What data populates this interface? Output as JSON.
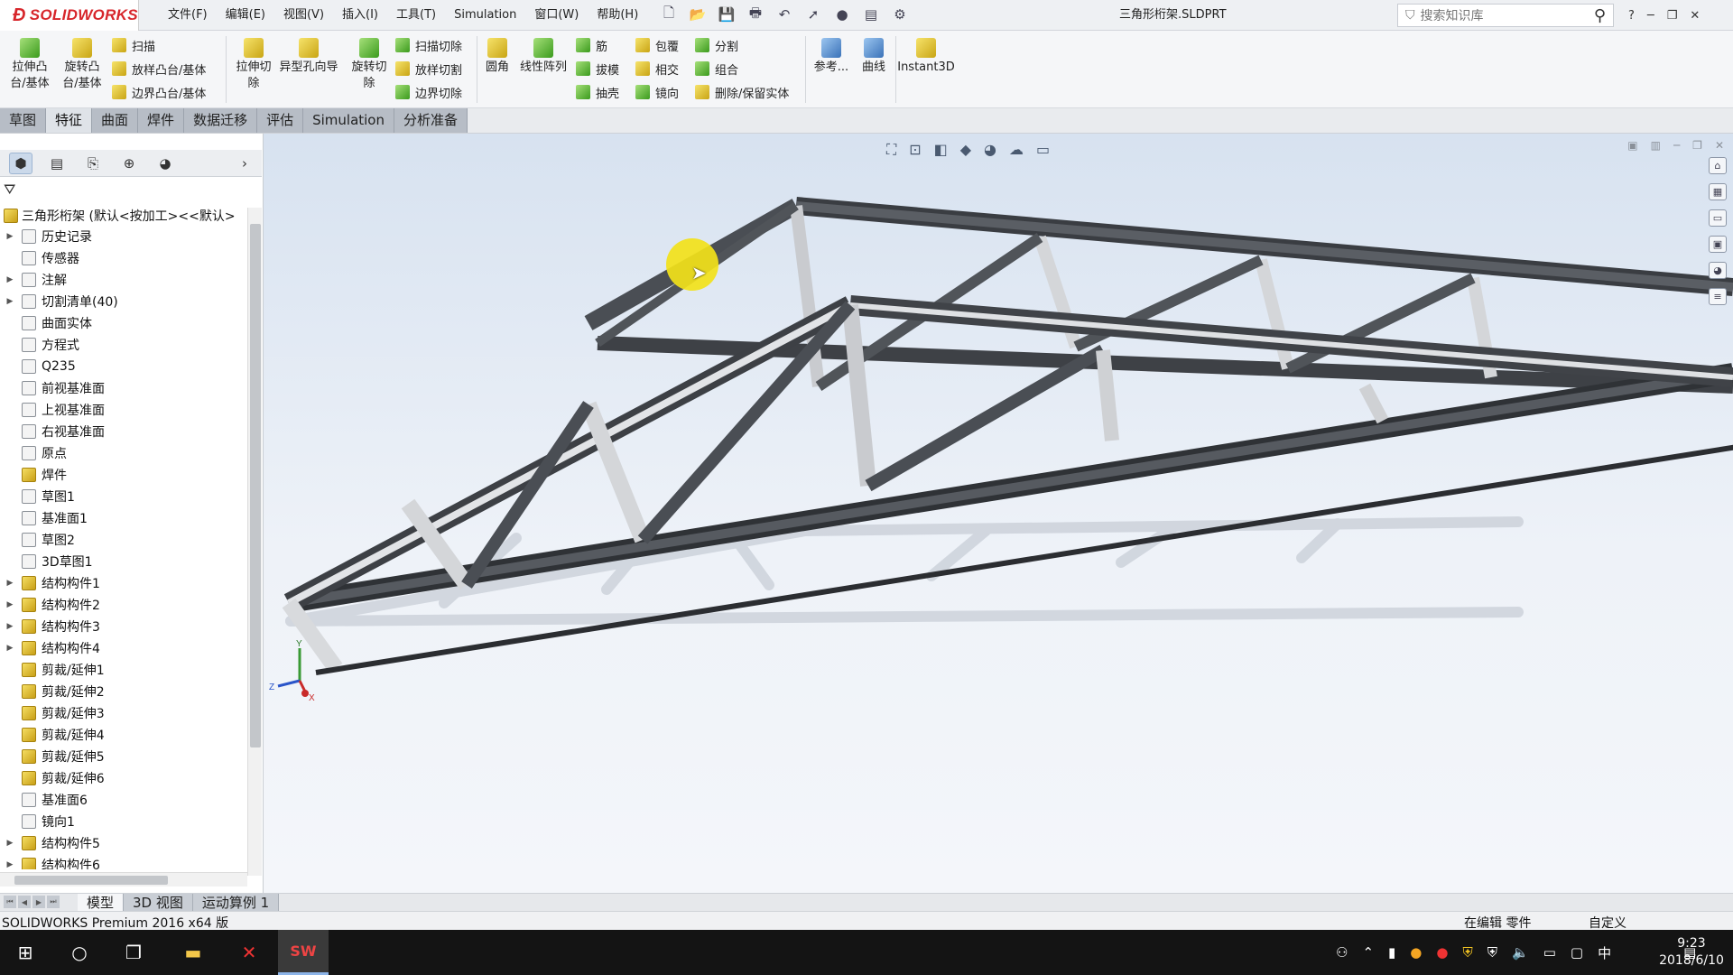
{
  "app": {
    "logo_text": "SOLIDWORKS",
    "document_title": "三角形桁架.SLDPRT"
  },
  "menu": [
    "文件(F)",
    "编辑(E)",
    "视图(V)",
    "插入(I)",
    "工具(T)",
    "Simulation",
    "窗口(W)",
    "帮助(H)"
  ],
  "search": {
    "placeholder": "搜索知识库"
  },
  "ribbon": {
    "extrude_boss": "拉伸凸\n台/基体",
    "revolve_boss": "旋转凸\n台/基体",
    "sweep": "扫描",
    "loft": "放样凸台/基体",
    "boundary_boss": "边界凸台/基体",
    "extrude_cut": "拉伸切\n除",
    "hole_wizard": "异型孔向导",
    "revolve_cut": "旋转切\n除",
    "swept_cut": "扫描切除",
    "lofted_cut": "放样切割",
    "boundary_cut": "边界切除",
    "fillet": "圆角",
    "linear_pattern": "线性阵列",
    "rib": "筋",
    "draft": "拔模",
    "shell": "抽壳",
    "wrap": "包覆",
    "intersect": "相交",
    "mirror": "镜向",
    "split": "分割",
    "combine": "组合",
    "delete_keep_body": "删除/保留实体",
    "reference": "参考...",
    "curves": "曲线",
    "instant3d": "Instant3D"
  },
  "tabs": [
    {
      "label": "草图",
      "active": false
    },
    {
      "label": "特征",
      "active": true
    },
    {
      "label": "曲面",
      "active": false
    },
    {
      "label": "焊件",
      "active": false
    },
    {
      "label": "数据迁移",
      "active": false
    },
    {
      "label": "评估",
      "active": false
    },
    {
      "label": "Simulation",
      "active": false
    },
    {
      "label": "分析准备",
      "active": false
    }
  ],
  "tree": {
    "root": "三角形桁架  (默认<按加工><<默认>",
    "items": [
      {
        "label": "历史记录",
        "expandable": true
      },
      {
        "label": "传感器",
        "expandable": false
      },
      {
        "label": "注解",
        "expandable": true
      },
      {
        "label": "切割清单(40)",
        "expandable": true
      },
      {
        "label": "曲面实体",
        "expandable": false
      },
      {
        "label": "方程式",
        "expandable": false
      },
      {
        "label": "Q235",
        "expandable": false
      },
      {
        "label": "前视基准面",
        "expandable": false
      },
      {
        "label": "上视基准面",
        "expandable": false
      },
      {
        "label": "右视基准面",
        "expandable": false
      },
      {
        "label": "原点",
        "expandable": false
      },
      {
        "label": "焊件",
        "expandable": false
      },
      {
        "label": "草图1",
        "expandable": false
      },
      {
        "label": "基准面1",
        "expandable": false
      },
      {
        "label": "草图2",
        "expandable": false
      },
      {
        "label": "3D草图1",
        "expandable": false
      },
      {
        "label": "结构构件1",
        "expandable": true
      },
      {
        "label": "结构构件2",
        "expandable": true
      },
      {
        "label": "结构构件3",
        "expandable": true
      },
      {
        "label": "结构构件4",
        "expandable": true
      },
      {
        "label": "剪裁/延伸1",
        "expandable": false
      },
      {
        "label": "剪裁/延伸2",
        "expandable": false
      },
      {
        "label": "剪裁/延伸3",
        "expandable": false
      },
      {
        "label": "剪裁/延伸4",
        "expandable": false
      },
      {
        "label": "剪裁/延伸5",
        "expandable": false
      },
      {
        "label": "剪裁/延伸6",
        "expandable": false
      },
      {
        "label": "基准面6",
        "expandable": false
      },
      {
        "label": "镜向1",
        "expandable": false
      },
      {
        "label": "结构构件5",
        "expandable": true
      },
      {
        "label": "结构构件6",
        "expandable": true
      }
    ]
  },
  "bottom_tabs": [
    {
      "label": "模型",
      "active": true
    },
    {
      "label": "3D 视图",
      "active": false
    },
    {
      "label": "运动算例 1",
      "active": false
    }
  ],
  "status": {
    "left": "SOLIDWORKS Premium 2016 x64 版",
    "middle": "在编辑 零件",
    "right": "自定义"
  },
  "triad": {
    "x": "X",
    "y": "Y",
    "z": "Z"
  },
  "clock": {
    "time": "9:23",
    "date": "2018/6/10"
  },
  "tray": {
    "ime": "中"
  }
}
